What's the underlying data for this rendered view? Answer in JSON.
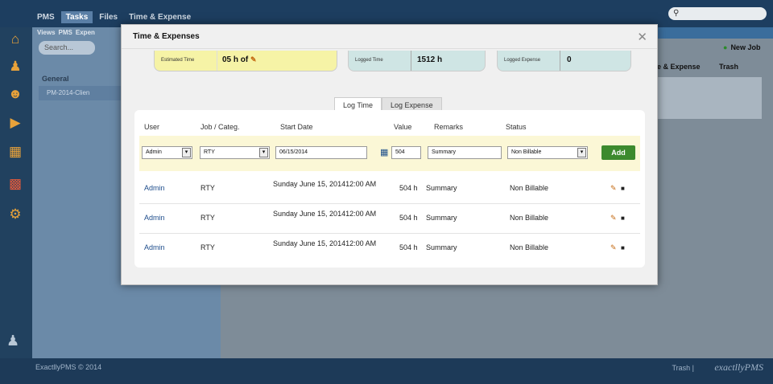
{
  "app": {
    "top_nav": [
      "PMS",
      "Tasks",
      "Files",
      "Time & Expense"
    ],
    "active_top_nav": "Tasks",
    "sub_nav": [
      "Views",
      "PMS",
      "Expen"
    ],
    "search_placeholder": "Search...",
    "group_title": "General",
    "group_item": "PM-2014-Clien",
    "new_job_label": "New Job",
    "expense_tab_label": "e & Expense",
    "trash_label": "Trash",
    "footer_copyright": "ExactllyPMS © 2014",
    "footer_trash": "Trash |",
    "footer_brand": "exactllyPMS"
  },
  "modal": {
    "title": "Time & Expenses",
    "stats": {
      "estimated": {
        "label": "Estimated Time",
        "value": "05 h of"
      },
      "logged_time": {
        "label": "Logged Time",
        "value": "1512 h"
      },
      "logged_expense": {
        "label": "Logged Expense",
        "value": "0"
      }
    },
    "tabs": [
      "Log Time",
      "Log Expense"
    ],
    "active_tab": "Log Time",
    "columns": [
      "User",
      "Job / Categ.",
      "Start Date",
      "Value",
      "Remarks",
      "Status"
    ],
    "entry": {
      "user": "Admin",
      "job": "RTY",
      "date": "06/15/2014",
      "value": "504",
      "remarks": "Summary",
      "status": "Non Billable",
      "add_label": "Add"
    },
    "rows": [
      {
        "user": "Admin",
        "job": "RTY",
        "date": "Sunday June 15, 201412:00 AM",
        "value": "504 h",
        "remarks": "Summary",
        "status": "Non Billable"
      },
      {
        "user": "Admin",
        "job": "RTY",
        "date": "Sunday June 15, 201412:00 AM",
        "value": "504 h",
        "remarks": "Summary",
        "status": "Non Billable"
      },
      {
        "user": "Admin",
        "job": "RTY",
        "date": "Sunday June 15, 201412:00 AM",
        "value": "504 h",
        "remarks": "Summary",
        "status": "Non Billable"
      }
    ]
  }
}
